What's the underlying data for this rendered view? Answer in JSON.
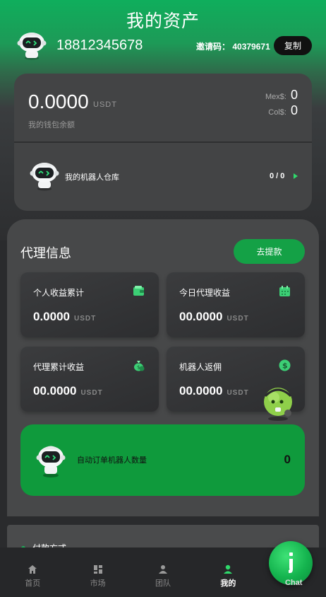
{
  "header": {
    "title": "我的资产"
  },
  "user": {
    "phone": "18812345678",
    "invite_label": "邀请码：",
    "invite_code": "40379671",
    "copy_label": "复制"
  },
  "wallet": {
    "balance": "0.0000",
    "unit": "USDT",
    "caption": "我的钱包余额",
    "mex_label": "Mex$:",
    "mex_value": "0",
    "col_label": "Col$:",
    "col_value": "0",
    "robot_label": "我的机器人仓库",
    "robot_count": "0 / 0"
  },
  "agent": {
    "title": "代理信息",
    "withdraw_label": "去提款",
    "cards": [
      {
        "label": "个人收益累计",
        "value": "0.0000",
        "unit": "USDT",
        "icon": "wallet-icon"
      },
      {
        "label": "今日代理收益",
        "value": "00.0000",
        "unit": "USDT",
        "icon": "calendar-icon"
      },
      {
        "label": "代理累计收益",
        "value": "00.0000",
        "unit": "USDT",
        "icon": "money-bag-icon"
      },
      {
        "label": "机器人返佣",
        "value": "00.0000",
        "unit": "USDT",
        "icon": "dollar-coin-icon"
      }
    ],
    "auto_label": "自动订单机器人数量",
    "auto_count": "0"
  },
  "payment": {
    "label": "付款方式"
  },
  "nav": {
    "items": [
      {
        "label": "首页",
        "icon": "home-icon"
      },
      {
        "label": "市场",
        "icon": "market-icon"
      },
      {
        "label": "团队",
        "icon": "team-icon"
      },
      {
        "label": "我的",
        "icon": "user-icon",
        "active": true
      },
      {
        "label": "Chat",
        "icon": "chat-icon"
      }
    ]
  },
  "colors": {
    "accent": "#14a146",
    "brand_green": "#0fae5c",
    "card_bg": "#434445"
  }
}
